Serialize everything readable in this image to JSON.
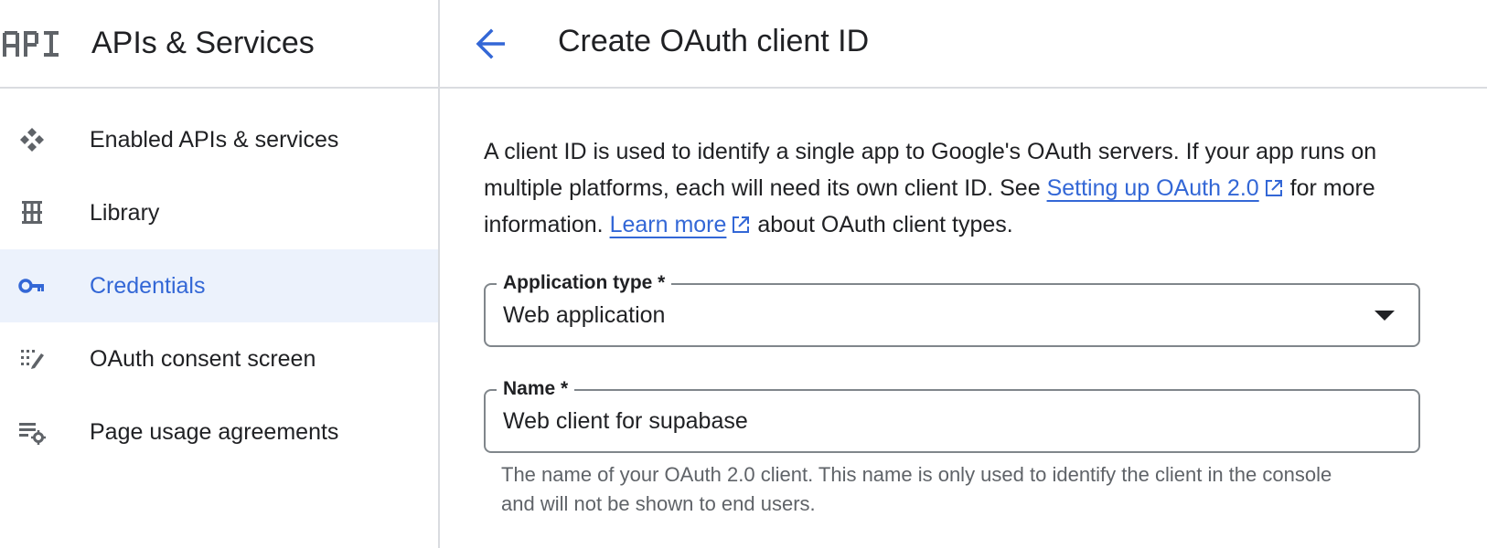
{
  "sidebar": {
    "logo_text": "API",
    "title": "APIs & Services",
    "items": [
      {
        "label": "Enabled APIs & services",
        "icon": "enabled-apis-icon",
        "active": false
      },
      {
        "label": "Library",
        "icon": "library-icon",
        "active": false
      },
      {
        "label": "Credentials",
        "icon": "key-icon",
        "active": true
      },
      {
        "label": "OAuth consent screen",
        "icon": "consent-screen-icon",
        "active": false
      },
      {
        "label": "Page usage agreements",
        "icon": "settings-list-icon",
        "active": false
      }
    ]
  },
  "header": {
    "back_icon": "arrow-back-icon",
    "title": "Create OAuth client ID"
  },
  "intro": {
    "text_1": "A client ID is used to identify a single app to Google's OAuth servers. If your app runs on multiple platforms, each will need its own client ID. See ",
    "link_1": "Setting up OAuth 2.0",
    "text_2": " for more information. ",
    "link_2": "Learn more",
    "text_3": " about OAuth client types."
  },
  "form": {
    "application_type": {
      "label": "Application type *",
      "value": "Web application"
    },
    "name": {
      "label": "Name *",
      "value": "Web client for supabase",
      "hint": "The name of your OAuth 2.0 client. This name is only used to identify the client in the console and will not be shown to end users."
    }
  },
  "colors": {
    "accent": "#3367d6",
    "active_bg": "#ecf2fc",
    "text": "#202124",
    "muted": "#5f6368",
    "border": "#dadce0"
  }
}
